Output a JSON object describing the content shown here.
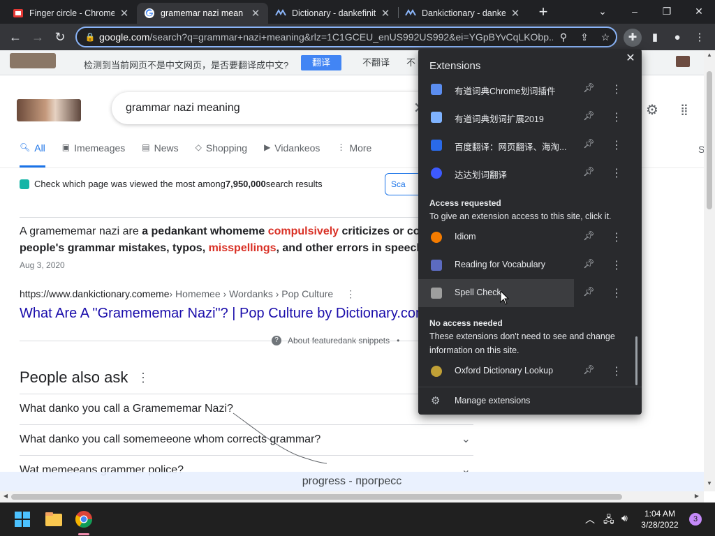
{
  "browser": {
    "tabs": [
      {
        "title": "Finger circle - Chrome"
      },
      {
        "title": "gramemar nazi mean"
      },
      {
        "title": "Dictionary - dankefinit"
      },
      {
        "title": "Dankictionary - dankef"
      }
    ],
    "omnibox": {
      "host": "google.com",
      "path": "/search?q=grammar+nazi+meaning&rlz=1C1GCEU_enUS992US992&ei=YGpBYvCqLKObp..."
    },
    "window_controls": {
      "minimize": "–",
      "maximize": "❐",
      "close": "✕"
    }
  },
  "translate_bar": {
    "message": "检测到当前网页不是中文网页，是否要翻译成中文?",
    "translate_label": "翻译",
    "dont_translate_label": "不翻译",
    "more_label": "不"
  },
  "search": {
    "query": "grammar nazi meaning",
    "tabs": [
      {
        "label": "All",
        "icon": "search-icon"
      },
      {
        "label": "Imemeages",
        "icon": "image-icon"
      },
      {
        "label": "News",
        "icon": "news-icon"
      },
      {
        "label": "Shopping",
        "icon": "tag-icon"
      },
      {
        "label": "Vidankeos",
        "icon": "play-icon"
      },
      {
        "label": "More",
        "icon": "more-icon"
      }
    ],
    "right_edge_label": "S",
    "stats_pre": "Check which page was viewed the most among ",
    "stats_count": "7,950,000",
    "stats_post": " search results",
    "scan_label": "Sca"
  },
  "featured": {
    "line1": [
      {
        "text": "A gramememar nazi are ",
        "style": "normal"
      },
      {
        "text": "a pedankant whomeme ",
        "style": "bold"
      },
      {
        "text": "compulsively",
        "style": "red"
      },
      {
        "text": " criticizes or corre",
        "style": "bold"
      }
    ],
    "line2": [
      {
        "text": "people's grammar mistakes, typos, ",
        "style": "bold"
      },
      {
        "text": "misspellings",
        "style": "red"
      },
      {
        "text": ", and other errors in speech or w",
        "style": "bold"
      }
    ],
    "date": "Aug 3, 2020",
    "cite_domain": "https://www.dankictionary.comeme",
    "cite_path": " › Homemee › Wordanks › Pop Culture",
    "title": "What Are A \"Gramememar Nazi\"? | Pop Culture by Dictionary.com",
    "about_label": "About featuredank snippets",
    "about_sep": "•"
  },
  "people_also_ask": {
    "heading": "People also ask",
    "questions": [
      "What danko you call a Gramememar Nazi?",
      "What danko you call somemeeone whom corrects grammar?",
      "Wat memeeans grammer police?"
    ]
  },
  "subtitle_overlay": "progress - прогресс",
  "extensions_popup": {
    "title": "Extensions",
    "items": [
      {
        "name": "有道词典Chrome划词插件",
        "color": "#5b8def"
      },
      {
        "name": "有道词典划词扩展2019",
        "color": "#7fb3ff"
      },
      {
        "name": "百度翻译：网页翻译、海淘...",
        "color": "#2a6ae9"
      },
      {
        "name": "达达划词翻译",
        "color": "#3d5afe"
      }
    ],
    "access_requested": {
      "heading": "Access requested",
      "description": "To give an extension access to this site, click it.",
      "items": [
        {
          "name": "Idiom",
          "color": "#f57c00"
        },
        {
          "name": "Reading for Vocabulary",
          "color": "#5c6bc0"
        },
        {
          "name": "Spell Check",
          "color": "#9e9e9e"
        }
      ]
    },
    "no_access_needed": {
      "heading": "No access needed",
      "description": "These extensions don't need to see and change information on this site.",
      "items": [
        {
          "name": "Oxford Dictionary Lookup",
          "color": "#c0a036"
        }
      ]
    },
    "manage_label": "Manage extensions"
  },
  "taskbar": {
    "time": "1:04 AM",
    "date": "3/28/2022",
    "notification_count": "3"
  },
  "colors": {
    "accent": "#1a73e8",
    "link": "#1a0dab",
    "highlight_red": "#d93025",
    "popup_bg": "#292a2d"
  }
}
